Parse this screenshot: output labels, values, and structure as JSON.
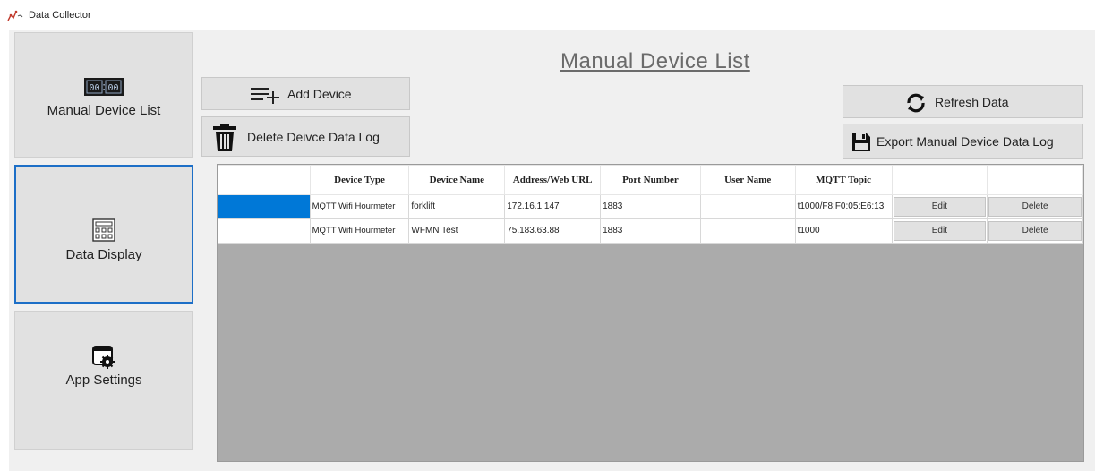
{
  "window": {
    "title": "Data Collector",
    "icon": "network-chart-icon"
  },
  "sidebar": {
    "items": [
      {
        "label": "Manual Device List",
        "icon": "device-counter-icon",
        "active": false
      },
      {
        "label": "Data Display",
        "icon": "calculator-grid-icon",
        "active": true
      },
      {
        "label": "App Settings",
        "icon": "window-gear-icon",
        "active": false
      }
    ]
  },
  "main": {
    "title": "Manual Device List",
    "toolbar": {
      "add_label": "Add Device",
      "delete_log_label": "Delete Deivce Data Log",
      "refresh_label": "Refresh Data",
      "export_label": "Export Manual Device Data Log"
    },
    "grid": {
      "columns": [
        "",
        "Device Type",
        "Device Name",
        "Address/Web URL",
        "Port Number",
        "User Name",
        "MQTT Topic",
        "",
        ""
      ],
      "rows": [
        {
          "device_type": "MQTT Wifi Hourmeter",
          "device_name": "forklift",
          "address": "172.16.1.147",
          "port": "1883",
          "user_name": "",
          "topic": "t1000/F8:F0:05:E6:13",
          "edit": "Edit",
          "delete": "Delete",
          "selected": true
        },
        {
          "device_type": "MQTT Wifi Hourmeter",
          "device_name": "WFMN Test",
          "address": "75.183.63.88",
          "port": "1883",
          "user_name": "",
          "topic": "t1000",
          "edit": "Edit",
          "delete": "Delete",
          "selected": false
        }
      ]
    }
  },
  "colors": {
    "accent": "#0078d7",
    "active_border": "#1d6fc7",
    "grid_background": "#ababab",
    "title": "#6b6b6b"
  }
}
